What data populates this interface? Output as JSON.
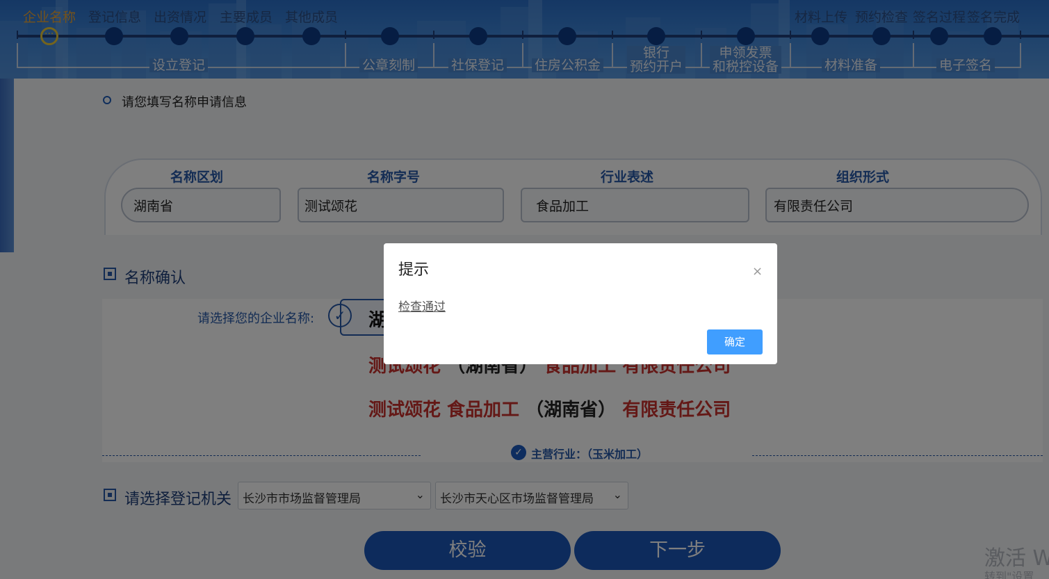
{
  "progress": {
    "top_steps": [
      "企业名称",
      "登记信息",
      "出资情况",
      "主要成员",
      "其他成员"
    ],
    "top_steps_right": [
      "材料上传",
      "预约检查",
      "签名过程",
      "签名完成"
    ],
    "groups": [
      "设立登记",
      "公章刻制",
      "社保登记",
      "住房公积金",
      "银行\n预约开户",
      "申领发票\n和税控设备",
      "材料准备",
      "电子签名"
    ]
  },
  "form": {
    "info_title": "请您填写名称申请信息",
    "columns": [
      {
        "label": "名称区划",
        "value": "湖南省"
      },
      {
        "label": "名称字号",
        "value": "测试颂花"
      },
      {
        "label": "行业表述",
        "value": "食品加工"
      },
      {
        "label": "组织形式",
        "value": "有限责任公司"
      }
    ]
  },
  "confirm": {
    "title": "名称确认",
    "choose_label": "请选择您的企业名称:",
    "selected_name_partial": "湖",
    "option_1": {
      "part1": "测试颂花",
      "part2": "（湖南省）",
      "part3": "食品加工",
      "part4": "有限责任公司"
    },
    "option_2": {
      "part1": "测试颂花 食品加工",
      "part2": "（湖南省）",
      "part3": "有限责任公司"
    },
    "industry": "主营行业：（玉米加工）"
  },
  "registration": {
    "title": "请选择登记机关",
    "select_1": "长沙市市场监督管理局",
    "select_2": "长沙市天心区市场监督管理局"
  },
  "buttons": {
    "verify": "校验",
    "next": "下一步"
  },
  "watermark": {
    "line1": "激活 W",
    "line2": "转到\"设置"
  },
  "modal": {
    "title": "提示",
    "close": "×",
    "body": "检查通过",
    "ok": "确定"
  },
  "colors": {
    "primary_blue": "#1a56b8",
    "accent_orange": "#e8a437",
    "name_red": "#c8302d",
    "modal_button": "#409eff"
  }
}
